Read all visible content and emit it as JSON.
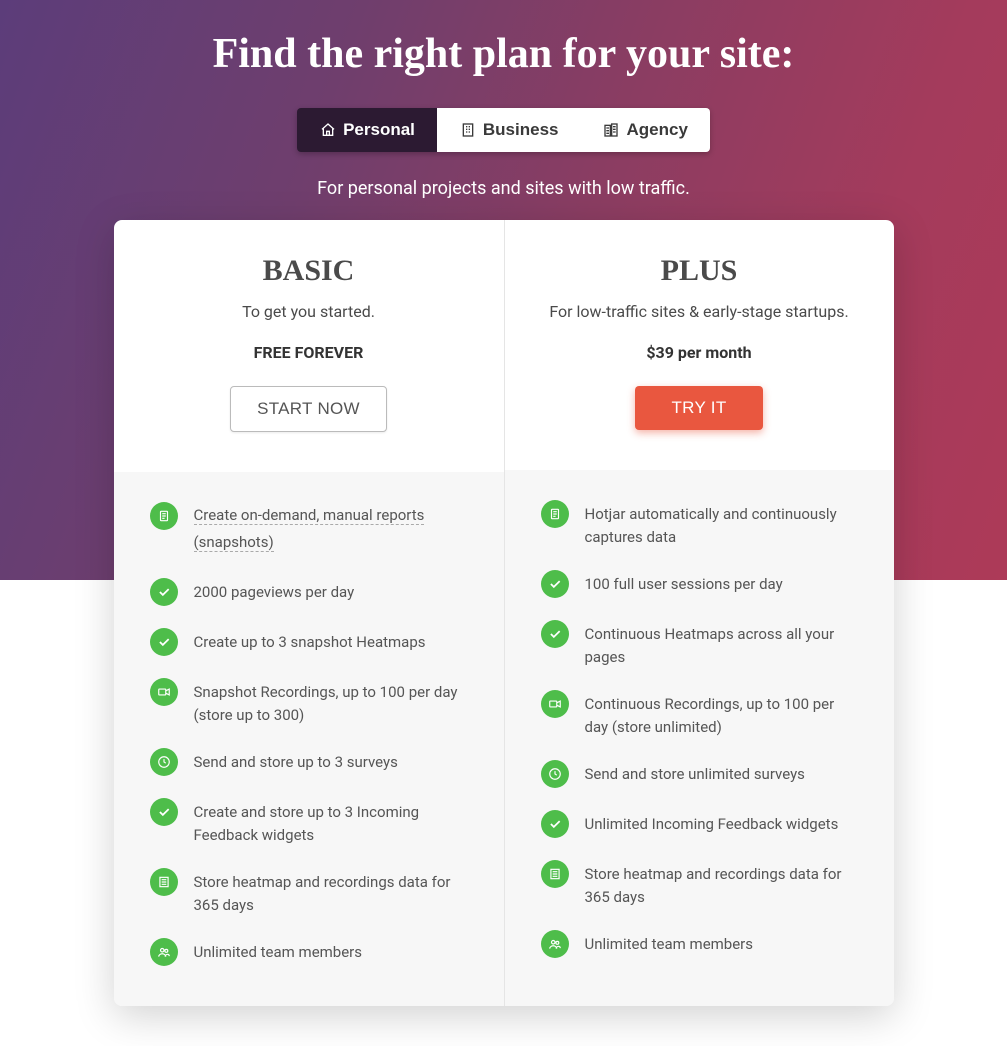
{
  "heading": "Find the right plan for your site:",
  "tabs": [
    {
      "label": "Personal",
      "icon": "home-icon",
      "active": true
    },
    {
      "label": "Business",
      "icon": "building-icon",
      "active": false
    },
    {
      "label": "Agency",
      "icon": "office-icon",
      "active": false
    }
  ],
  "subheading": "For personal projects and sites with low traffic.",
  "plans": [
    {
      "name": "BASIC",
      "desc": "To get you started.",
      "price": "FREE FOREVER",
      "cta_label": "START NOW",
      "cta_style": "outline",
      "features": [
        {
          "icon": "doc-icon",
          "text": "Create on-demand, manual reports (snapshots)",
          "underlined": true
        },
        {
          "icon": "check-icon",
          "text": "2000 pageviews per day"
        },
        {
          "icon": "check-icon",
          "text": "Create up to 3 snapshot Heatmaps"
        },
        {
          "icon": "video-icon",
          "text": "Snapshot Recordings, up to 100 per day (store up to 300)"
        },
        {
          "icon": "clock-icon",
          "text": "Send and store up to 3 surveys"
        },
        {
          "icon": "check-icon",
          "text": "Create and store up to 3 Incoming Feedback widgets"
        },
        {
          "icon": "data-icon",
          "text": "Store heatmap and recordings data for 365 days"
        },
        {
          "icon": "team-icon",
          "text": "Unlimited team members"
        }
      ]
    },
    {
      "name": "PLUS",
      "desc": "For low-traffic sites & early-stage startups.",
      "price": "$39 per month",
      "cta_label": "TRY IT",
      "cta_style": "primary",
      "features": [
        {
          "icon": "doc-icon",
          "text": "Hotjar automatically and continuously captures data"
        },
        {
          "icon": "check-icon",
          "text": "100 full user sessions per day"
        },
        {
          "icon": "check-icon",
          "text": "Continuous Heatmaps across all your pages"
        },
        {
          "icon": "video-icon",
          "text": "Continuous Recordings, up to 100 per day (store unlimited)"
        },
        {
          "icon": "clock-icon",
          "text": "Send and store unlimited surveys"
        },
        {
          "icon": "check-icon",
          "text": "Unlimited Incoming Feedback widgets"
        },
        {
          "icon": "data-icon",
          "text": "Store heatmap and recordings data for 365 days"
        },
        {
          "icon": "team-icon",
          "text": "Unlimited team members"
        }
      ]
    }
  ]
}
